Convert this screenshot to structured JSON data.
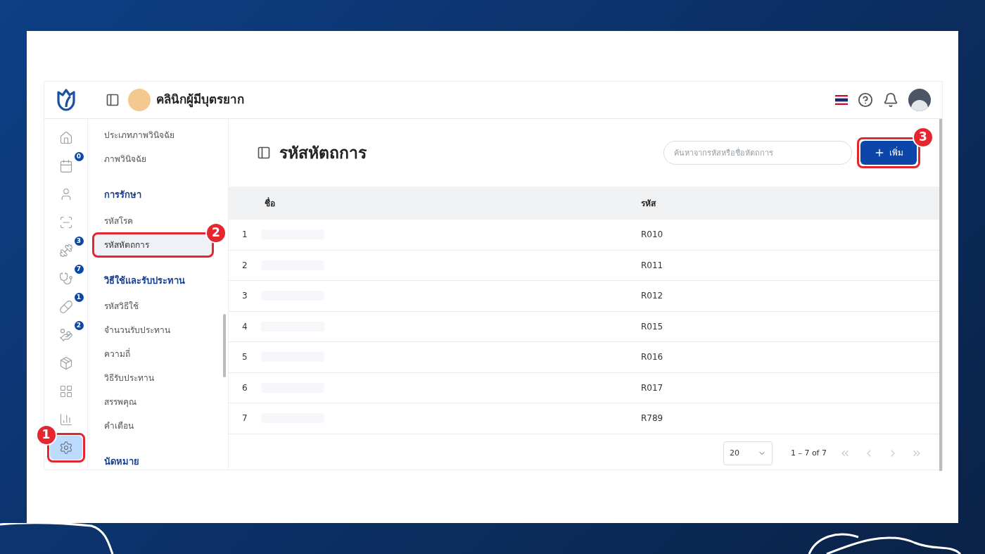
{
  "header": {
    "clinic_name": "คลินิกผู้มีบุตรยาก"
  },
  "rail": [
    {
      "selected": false
    },
    {
      "badge": "0",
      "selected": false
    },
    {
      "selected": false
    },
    {
      "selected": false
    },
    {
      "badge": "3",
      "selected": false
    },
    {
      "badge": "7",
      "selected": false
    },
    {
      "badge": "1",
      "selected": false
    },
    {
      "badge": "2",
      "selected": false
    },
    {
      "selected": false
    },
    {
      "selected": false
    },
    {
      "selected": false
    },
    {
      "selected": true,
      "callout": "1"
    }
  ],
  "submenu": [
    {
      "kind": "item",
      "label": "ประเภทภาพวินิจฉัย",
      "selected": false
    },
    {
      "kind": "item",
      "label": "ภาพวินิจฉัย",
      "selected": false
    },
    {
      "kind": "heading",
      "label": "การรักษา"
    },
    {
      "kind": "item",
      "label": "รหัสโรค",
      "selected": false
    },
    {
      "kind": "item",
      "label": "รหัสหัตถการ",
      "selected": true,
      "callout": "2"
    },
    {
      "kind": "heading",
      "label": "วิธีใช้และรับประทาน"
    },
    {
      "kind": "item",
      "label": "รหัสวิธีใช้",
      "selected": false
    },
    {
      "kind": "item",
      "label": "จำนวนรับประทาน",
      "selected": false
    },
    {
      "kind": "item",
      "label": "ความถี่",
      "selected": false
    },
    {
      "kind": "item",
      "label": "วิธีรับประทาน",
      "selected": false
    },
    {
      "kind": "item",
      "label": "สรรพคุณ",
      "selected": false
    },
    {
      "kind": "item",
      "label": "คำเตือน",
      "selected": false
    },
    {
      "kind": "heading",
      "label": "นัดหมาย"
    }
  ],
  "page": {
    "title": "รหัสหัตถการ",
    "search": {
      "placeholder": "ค้นหาจากรหัสหรือชื่อหัตถการ"
    },
    "add_button": {
      "label": "เพิ่ม",
      "callout": "3"
    }
  },
  "table": {
    "columns": [
      "ชื่อ",
      "รหัส"
    ],
    "rows": [
      {
        "index": "1",
        "code": "R010"
      },
      {
        "index": "2",
        "code": "R011"
      },
      {
        "index": "3",
        "code": "R012"
      },
      {
        "index": "4",
        "code": "R015"
      },
      {
        "index": "5",
        "code": "R016"
      },
      {
        "index": "6",
        "code": "R017"
      },
      {
        "index": "7",
        "code": "R789"
      }
    ]
  },
  "pagination": {
    "page_size": "20",
    "range": "1 – 7 of 7"
  }
}
